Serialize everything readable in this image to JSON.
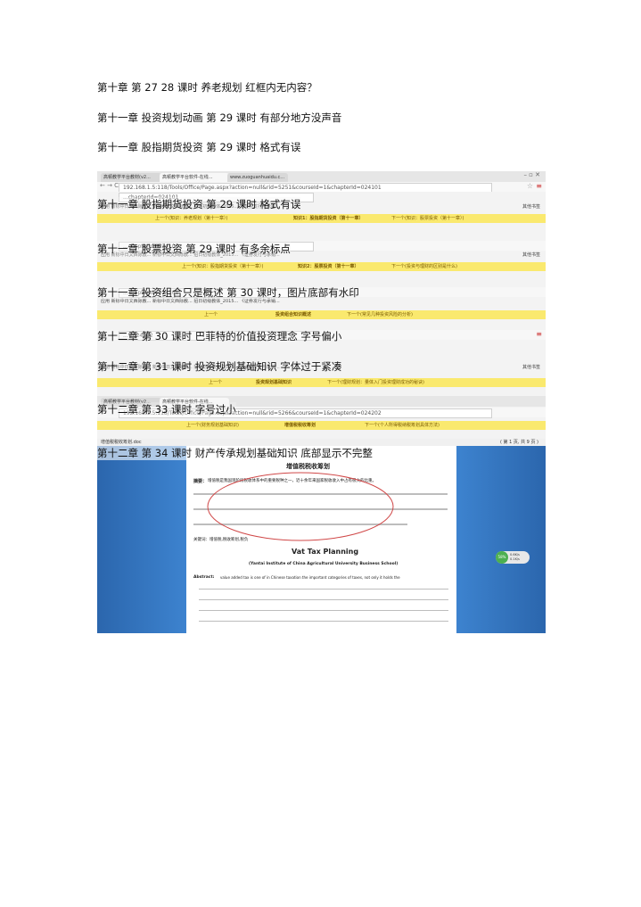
{
  "notes": [
    "第十章 第 27 28 课时 养老规划 红框内无内容？",
    "第十一章 投资规划动画 第 29 课时 有部分地方没声音",
    "第十一章 股指期货投资 第 29 课时  格式有误"
  ],
  "overlay_notes": [
    "第十一章 股指期货投资 第 29 课时  格式有误",
    "第十一章 股票投资 第 29 课时 有多余标点",
    "第十一章 投资组合只是概述  第 30 课时，图片底部有水印",
    "第十二章 第 30 课时 巴菲特的价值投资理念  字号偏小",
    "第十二章 第 31 课时 投资规划基础知识 字体过于紧凑",
    "第十二章 第 33 课时  字号过小",
    "第十二章  第 34 课时 财产传承规划基础知识  底部显示不完整"
  ],
  "browser": {
    "tab1": "高顿教学平台教材(v2...",
    "tab2": "高顿教学平台软件-在线...",
    "tab3": "www.zuoguanhuaidu.c...",
    "url1": "192.168.1.5:118/Tools/Office/Page.aspx?action=null&rid=5251&courseId=1&chapterId=024101",
    "url2": "...chapterId=024101",
    "url5": "...=024102",
    "url7": "192.168.1.5:118/Tools/Office/Page.aspx?action=null&rid=5266&courseId=1&chapterId=024202",
    "bookmarks": "应用   新标中日文西际教...   新标中日文西际教...   招日初级教体_2015...   《证券发行与承销...",
    "bookmarks_right": "其他书签"
  },
  "yellow_bars": [
    {
      "left": "上一个(知识：养老规划（第十一章）)",
      "center": "知识1：股指期货投资（第十一章）",
      "right": "下一个(知识：股票投资（第十一章）)"
    },
    {
      "left": "上一个(知识：股指期货投资（第十一章）)",
      "center": "知识2：股票投资（第十一章）",
      "right": "下一个(投资与理财的区别是什么)"
    },
    {
      "left": "上一个",
      "center": "投资组合知识概述",
      "right": "下一个(常见几种投资风险的分析)"
    },
    {
      "left": "上一个",
      "center": "投资规划基础知识",
      "right": "下一个(理财规划：量体入门投资理财成功的秘诀)"
    },
    {
      "left": "上一个(财务规划基础知识)",
      "center": "增值税税收筹划",
      "right": "下一个(个人所得税纳税筹划具体方法)"
    }
  ],
  "document": {
    "toolbar_label": "增值税税收筹划.doc",
    "page_indicator": "( 第 1 页, 共 9 页 )",
    "title_cn": "增值税税收筹划",
    "abstract_cn_label": "摘要：",
    "abstract_cn": "增值税是我国现阶段税收体系中的重要税种之一，近十余年来国家税收收入中占有很大的比重。",
    "keywords_cn": "关键词：增值税,税收筹划,税负",
    "title_en": "Vat Tax Planning",
    "affiliation_en": "(Yantai Institute of China Agricultural University Business School)",
    "abstract_en_label": "Abstract:",
    "abstract_en": "value added tax is one of in Chinese taxation the important categories of taxes, not only it holds the",
    "gauge_pct": "58%",
    "gauge_line1": "0.6K/s",
    "gauge_line2": "0.1K/s"
  },
  "colors": {
    "yellow_bar": "#fae96e",
    "doc_bg": "#2d6db5",
    "annotation": "#d04848"
  }
}
